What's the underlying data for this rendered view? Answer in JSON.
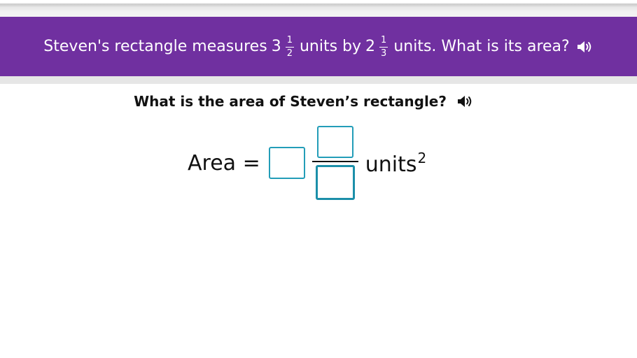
{
  "banner": {
    "prefix": "Steven's rectangle measures",
    "first": {
      "whole": "3",
      "numerator": "1",
      "denominator": "2"
    },
    "middle": "units by",
    "second": {
      "whole": "2",
      "numerator": "1",
      "denominator": "3"
    },
    "suffix": "units. What is its area?",
    "background": "#7030a0"
  },
  "question": {
    "text": "What is the area of Steven’s rectangle?"
  },
  "answer": {
    "label": "Area =",
    "whole_value": "",
    "numerator_value": "",
    "denominator_value": "",
    "units": "units",
    "exponent": "2",
    "accent": "#239db8"
  },
  "icons": {
    "audio": "speaker-icon"
  }
}
